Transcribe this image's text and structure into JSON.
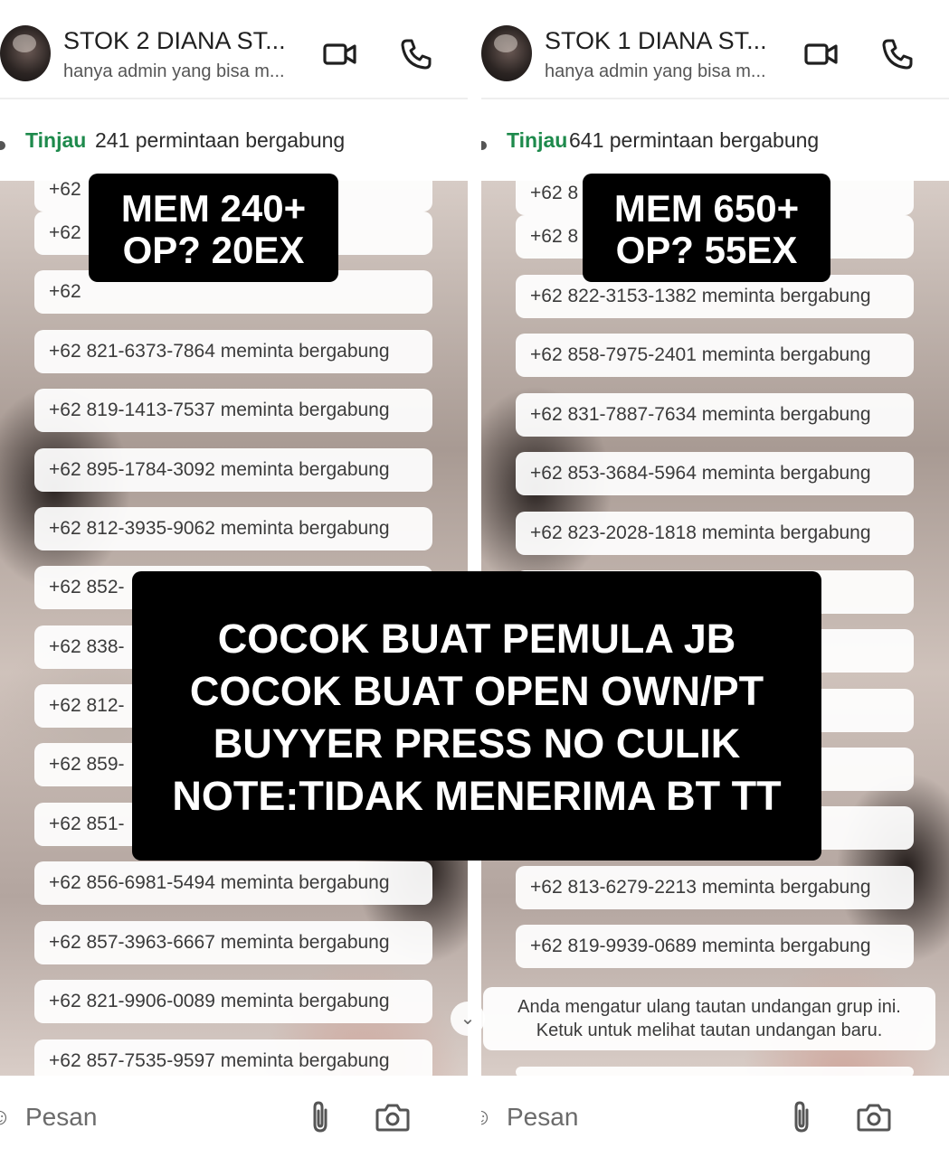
{
  "left_panel": {
    "header": {
      "title": "STOK 2 DIANA ST...",
      "subtitle": "hanya admin yang bisa m..."
    },
    "review_bar": {
      "link": "Tinjau",
      "text": "241 permintaan bergabung"
    },
    "stat_overlay": {
      "line1": "MEM 240+",
      "line2": "OP? 20EX"
    },
    "messages": [
      "+62 ",
      "+62 ",
      "+62 821-6373-7864 meminta bergabung",
      "+62 819-1413-7537 meminta bergabung",
      "+62 895-1784-3092 meminta bergabung",
      "+62 812-3935-9062 meminta bergabung",
      "+62 852-",
      "+62 838-",
      "+62 812-",
      "+62 859-",
      "+62 851-",
      "+62 856-6981-5494 meminta bergabung",
      "+62 857-3963-6667 meminta bergabung",
      "+62 821-9906-0089 meminta bergabung",
      "+62 857-7535-9597 meminta bergabung"
    ],
    "composer": {
      "placeholder": "Pesan"
    }
  },
  "right_panel": {
    "header": {
      "title": "STOK 1 DIANA ST...",
      "subtitle": "hanya admin yang bisa m..."
    },
    "review_bar": {
      "link": "Tinjau",
      "text": "641 permintaan bergabung"
    },
    "stat_overlay": {
      "line1": "MEM 650+",
      "line2": "OP? 55EX"
    },
    "messages": [
      "+62 8",
      "+62 822-3153-1382 meminta bergabung",
      "+62 858-7975-2401 meminta bergabung",
      "+62 831-7887-7634 meminta bergabung",
      "+62 853-3684-5964 meminta bergabung",
      "+62 823-2028-1818 meminta bergabung",
      "+62 813-6279-2213 meminta bergabung",
      "+62 819-9939-0689 meminta bergabung"
    ],
    "system_message": {
      "line1": "Anda mengatur ulang tautan undangan grup ini.",
      "line2": "Ketuk untuk melihat tautan undangan baru."
    },
    "composer": {
      "placeholder": "Pesan"
    }
  },
  "center_overlay": {
    "line1": "COCOK BUAT PEMULA JB",
    "line2": "COCOK BUAT OPEN OWN/PT",
    "line3": "BUYYER PRESS NO CULIK",
    "line4": "NOTE:TIDAK MENERIMA BT TT"
  },
  "colors": {
    "tinjau_link": "#1e8a4c",
    "icon": "#1f1f1f",
    "overlay_bg": "#000000",
    "overlay_text": "#ffffff"
  },
  "icons": [
    "video-call-icon",
    "voice-call-icon",
    "attachment-icon",
    "camera-icon",
    "emoji-icon",
    "chevron-down-icon"
  ]
}
